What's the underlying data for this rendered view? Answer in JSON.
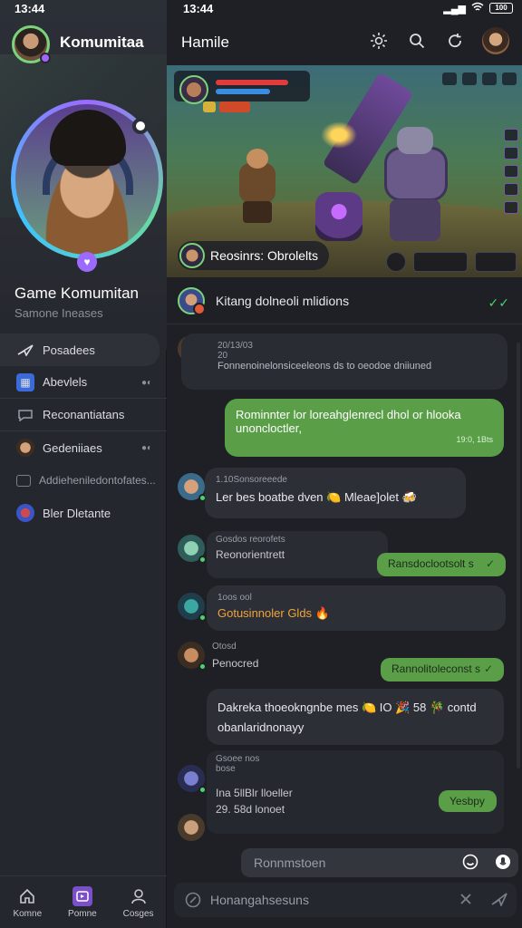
{
  "status": {
    "time_left": "13:44",
    "time_right": "13:44",
    "battery": "100"
  },
  "sidebar": {
    "app_name": "Komumitaa",
    "username": "Game Komumitan",
    "subtitle": "Samone Ineases",
    "items": [
      {
        "label": "Posadees",
        "icon": "paper-plane-icon"
      },
      {
        "label": "Abevlels",
        "icon": "server-icon"
      },
      {
        "label": "Reconantiatans",
        "icon": "chat-icon"
      },
      {
        "label": "Gedeniiaes",
        "icon": "avatar-icon"
      },
      {
        "label": "Addieheniledontofates...",
        "icon": "list-icon"
      },
      {
        "label": "Bler Dletante",
        "icon": "avatar-icon"
      }
    ],
    "tabs": [
      {
        "label": "Komne",
        "icon": "home-icon"
      },
      {
        "label": "Pomne",
        "icon": "game-icon"
      },
      {
        "label": "Cosges",
        "icon": "user-icon"
      }
    ]
  },
  "header": {
    "title": "Hamile"
  },
  "banner": {
    "chip_label": "Reosinrs: Obrolelts"
  },
  "thread": {
    "title": "Kitang dolneoli mlidions"
  },
  "messages": [
    {
      "id": "m1",
      "side": "in",
      "name": "20/13/03",
      "meta": "20",
      "text": "Fonnenoinelonsiceeleons ds to oeodoe dniiuned"
    },
    {
      "id": "m2",
      "side": "out",
      "text": "Rominnter lor loreahglenrecl dhol or hlooka unoncloctler,",
      "time": "19:0, 1Bts"
    },
    {
      "id": "m3",
      "side": "in",
      "name": "1.10Sonsoreeede",
      "text": "Ler bes boatbe dven 🍋 Mleae]olet 🍻"
    },
    {
      "id": "m4",
      "side": "in",
      "name": "Gosdos reorofets",
      "text": "Reonorientrett"
    },
    {
      "id": "m5",
      "side": "out_small",
      "text": "Ransdoclootsolt s"
    },
    {
      "id": "m6",
      "side": "in",
      "name": "1oos ool",
      "text": "Gotusinnoler Glds 🔥"
    },
    {
      "id": "m7",
      "side": "in",
      "name": "Otosd",
      "text": "Penocred"
    },
    {
      "id": "m8",
      "side": "out_small",
      "text": "Rannolitoleconst s"
    },
    {
      "id": "m9",
      "side": "in",
      "text": "Dakreka thoeokngnbe mes 🍋 IO 🎉 58 🎋 contd obanlaridnonayy"
    },
    {
      "id": "m10",
      "side": "in",
      "name": "Gsoee nos",
      "meta": "bose",
      "text": "Ina 5llBlr lloeller",
      "text2": "29. 58d lonoet"
    },
    {
      "id": "m11",
      "side": "out_small",
      "text": "Yesbpy"
    }
  ],
  "composer": {
    "placeholder1": "Ronnmstoen",
    "placeholder2": "Honangahsesuns"
  },
  "colors": {
    "accent_green": "#5a9f48",
    "accent_purple": "#9b6bff",
    "bg_dark": "#1e2026",
    "sidebar_bg": "#25272e"
  }
}
